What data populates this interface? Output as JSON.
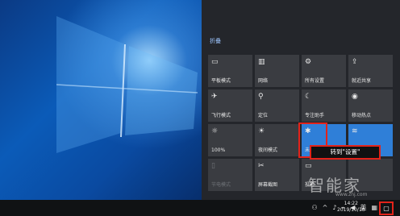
{
  "action_center": {
    "collapse_label": "折叠",
    "tiles": [
      {
        "label": "平板模式",
        "icon": "▭"
      },
      {
        "label": "网络",
        "icon": "▥"
      },
      {
        "label": "所有设置",
        "icon": "⚙"
      },
      {
        "label": "就近共享",
        "icon": "⇪"
      },
      {
        "label": "飞行模式",
        "icon": "✈"
      },
      {
        "label": "定位",
        "icon": "⚲"
      },
      {
        "label": "专注助手",
        "icon": "☾"
      },
      {
        "label": "移动热点",
        "icon": "◉"
      },
      {
        "label": "100%",
        "icon": "☼"
      },
      {
        "label": "夜间模式",
        "icon": "☀"
      },
      {
        "label": "未连接",
        "icon": "✱"
      },
      {
        "label": "",
        "icon": "≋"
      },
      {
        "label": "节电模式",
        "icon": "▯"
      },
      {
        "label": "屏幕截图",
        "icon": "✂"
      },
      {
        "label": "投影",
        "icon": "▭"
      },
      {
        "label": "",
        "icon": ""
      }
    ]
  },
  "callout_text": "转到\"设置\"",
  "watermark": {
    "text": "智能家",
    "url": "www.znj.com"
  },
  "taskbar": {
    "tray_person": "⚇",
    "tray_arrow": "^",
    "tray_mic": "♪",
    "tray_net": "⌁",
    "tray_vol": "◀",
    "tray_lang": "英",
    "tray_grid": "▦",
    "clock_time": "14:22",
    "clock_date": "2019/10/18",
    "notification_icon": "▢"
  },
  "colors": {
    "accent": "#2f7fd8",
    "highlight_red": "#e2231a"
  }
}
